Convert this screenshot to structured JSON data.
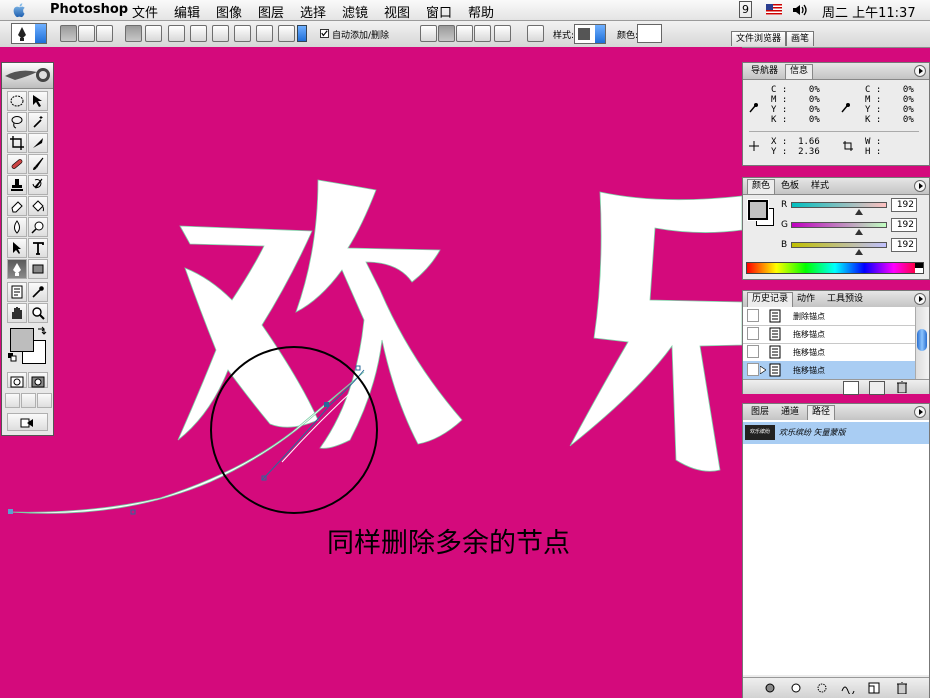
{
  "menubar": {
    "app_name": "Photoshop",
    "items": [
      "文件",
      "编辑",
      "图像",
      "图层",
      "选择",
      "滤镜",
      "视图",
      "窗口",
      "帮助"
    ],
    "script_indicator": "9",
    "clock": "周二 上午11:37"
  },
  "options_bar": {
    "auto_add_delete_label": "自动添加/删除",
    "auto_add_delete_checked": true,
    "style_label": "样式:",
    "color_label": "颜色:",
    "tab_file_browser": "文件浏览器",
    "tab_brushes": "画笔"
  },
  "canvas": {
    "background_color": "#d40a7c",
    "artwork_text": "欢乐",
    "caption": "同样删除多余的节点"
  },
  "info_panel": {
    "tab_navigator": "导航器",
    "tab_info": "信息",
    "cmyk_left": "C :    0%\nM :    0%\nY :    0%\nK :    0%",
    "cmyk_right": "C :    0%\nM :    0%\nY :    0%\nK :    0%",
    "xy": "X :  1.66\nY :  2.36",
    "wh": "W :\nH :"
  },
  "color_panel": {
    "tab_color": "颜色",
    "tab_swatches": "色板",
    "tab_styles": "样式",
    "r_label": "R",
    "g_label": "G",
    "b_label": "B",
    "r_value": "192",
    "g_value": "192",
    "b_value": "192"
  },
  "history_panel": {
    "tab_history": "历史记录",
    "tab_actions": "动作",
    "tab_presets": "工具预设",
    "items": [
      {
        "label": "删除锚点"
      },
      {
        "label": "拖移锚点"
      },
      {
        "label": "拖移锚点"
      },
      {
        "label": "拖移锚点"
      }
    ]
  },
  "paths_panel": {
    "tab_layers": "图层",
    "tab_channels": "通道",
    "tab_paths": "路径",
    "path_name": "欢乐缤纷 矢量蒙版",
    "thumb_text": "欢乐缤纷"
  }
}
